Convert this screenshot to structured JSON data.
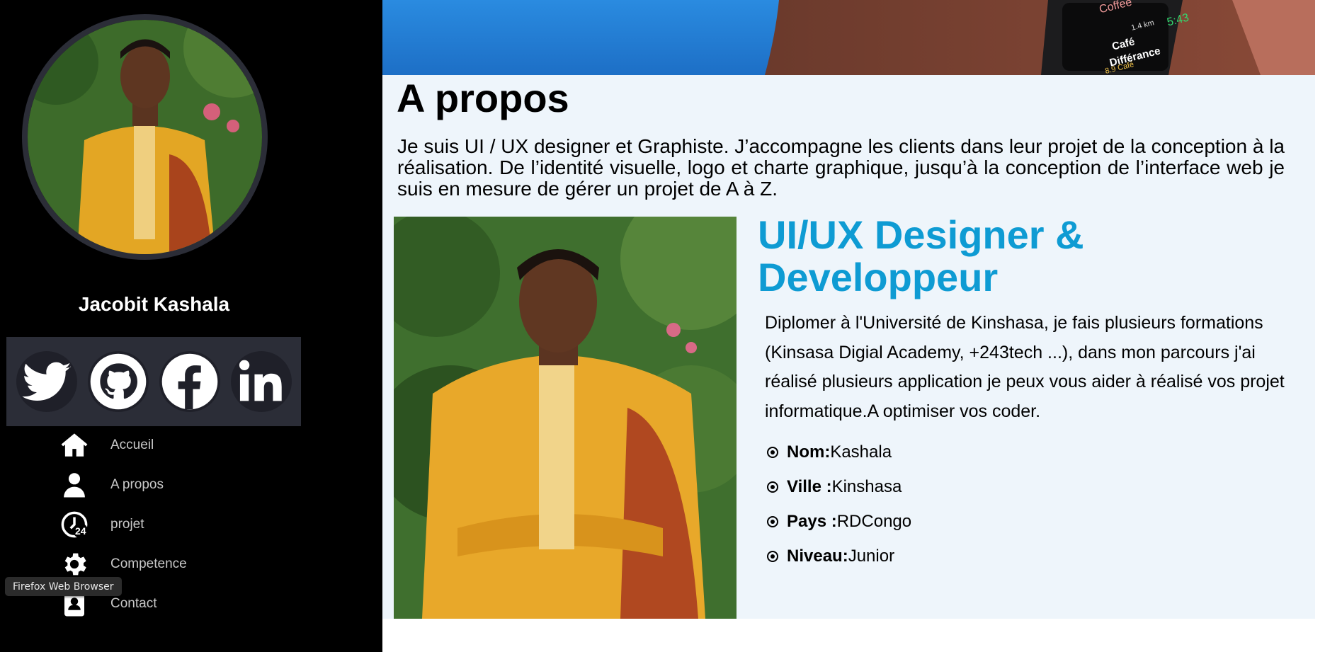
{
  "sidebar": {
    "name": "Jacobit Kashala",
    "socials": [
      {
        "icon": "twitter-icon"
      },
      {
        "icon": "github-icon"
      },
      {
        "icon": "facebook-icon"
      },
      {
        "icon": "linkedin-icon"
      }
    ],
    "nav": [
      {
        "label": "Accueil",
        "icon": "home-icon"
      },
      {
        "label": "A propos",
        "icon": "user-icon"
      },
      {
        "label": "projet",
        "icon": "clock-24-icon"
      },
      {
        "label": "Competence",
        "icon": "gear-icon"
      },
      {
        "label": "Contact",
        "icon": "contact-card-icon"
      }
    ]
  },
  "tooltip": "Firefox Web Browser",
  "banner": {
    "watch_app": "Coffee",
    "watch_time": "5:43",
    "watch_distance": "1.4 km",
    "watch_text_1": "Café",
    "watch_text_2": "Différance",
    "watch_rating": "8.9 Café"
  },
  "about": {
    "title": "A propos",
    "intro": "Je suis UI / UX designer et Graphiste. J’accompagne les clients dans leur projet de la conception à la réalisation. De l’identité visuelle, logo et charte graphique, jusqu’à la conception de l’interface web je suis en mesure de gérer un projet de A à Z.",
    "role_title": "UI/UX Designer & Developpeur",
    "description": "Diplomer à l'Université de Kinshasa, je fais plusieurs formations (Kinsasa Digial Academy, +243tech ...), dans mon parcours j'ai réalisé plusieurs application je peux vous aider à réalisé vos projet informatique.A optimiser vos coder.",
    "facts": [
      {
        "key": "Nom:",
        "value": "Kashala"
      },
      {
        "key": "Ville :",
        "value": "Kinshasa"
      },
      {
        "key": "Pays :",
        "value": "RDCongo"
      },
      {
        "key": "Niveau:",
        "value": "Junior"
      }
    ]
  },
  "colors": {
    "sidebar_bg": "#000000",
    "social_bar_bg": "#2b2d37",
    "about_bg": "#eef5fb",
    "accent": "#0e9bd3"
  }
}
